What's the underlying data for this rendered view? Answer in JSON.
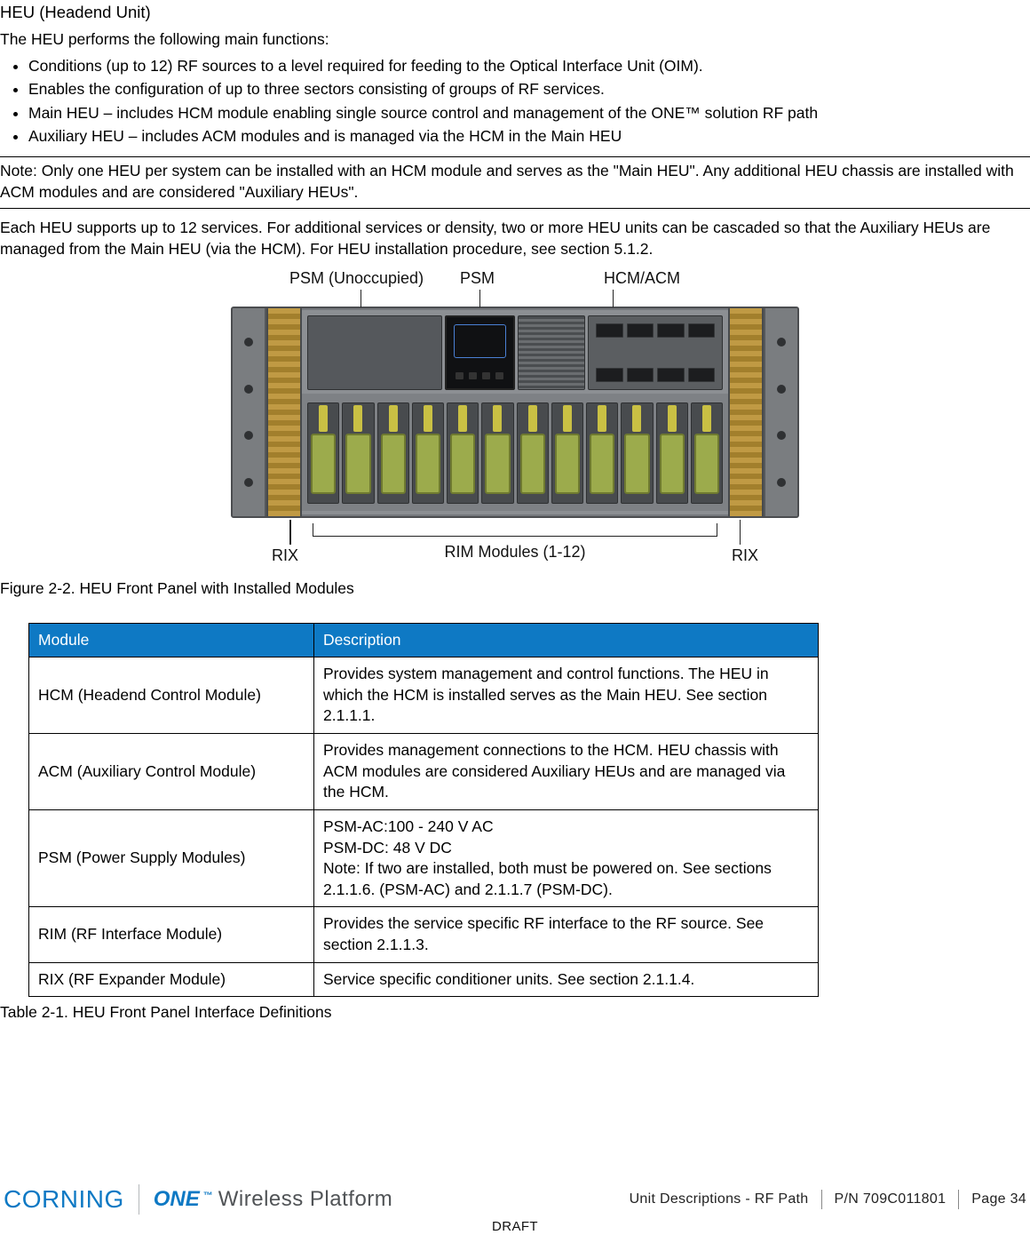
{
  "heading": "HEU (Headend Unit)",
  "intro": "The HEU performs the following main functions:",
  "bullets": [
    "Conditions (up to 12) RF sources to a level required for feeding to the Optical Interface Unit (OIM).",
    "Enables the configuration of up to three sectors consisting of groups of RF services.",
    "Main HEU – includes HCM module enabling single source control and management of the ONE™ solution RF path",
    "Auxiliary HEU – includes ACM modules and is managed via the HCM in the Main HEU"
  ],
  "note": "Note: Only one HEU per system can be installed with an HCM module and serves as the \"Main HEU\". Any additional HEU chassis are installed with ACM modules and are considered \"Auxiliary HEUs\".",
  "para2": "Each HEU supports up to 12 services. For additional services or density, two or more HEU units can be cascaded so that the Auxiliary HEUs are managed from the Main HEU (via the HCM). For HEU installation procedure, see section 5.1.2.",
  "figure": {
    "labels": {
      "psm_unoccupied": "PSM (Unoccupied)",
      "psm": "PSM",
      "hcm_acm": "HCM/ACM",
      "rix": "RIX",
      "rim_modules": "RIM Modules (1-12)"
    },
    "caption": "Figure 2-2. HEU Front Panel with Installed Modules"
  },
  "table": {
    "headers": {
      "module": "Module",
      "description": "Description"
    },
    "rows": [
      {
        "module": "HCM (Headend Control Module)",
        "description": "Provides system management and control functions. The HEU in which the HCM is installed serves as the Main HEU. See section 2.1.1.1."
      },
      {
        "module": "ACM (Auxiliary Control Module)",
        "description": "Provides management connections to the HCM. HEU chassis with ACM modules are considered Auxiliary HEUs and are managed via the HCM."
      },
      {
        "module": "PSM (Power Supply Modules)",
        "description": "PSM-AC:100 - 240 V AC\nPSM-DC: 48 V DC\nNote: If two are installed, both must be powered on. See sections 2.1.1.6. (PSM-AC) and 2.1.1.7 (PSM-DC)."
      },
      {
        "module": "RIM (RF Interface Module)",
        "description": "Provides the service specific RF interface to the RF source. See section 2.1.1.3."
      },
      {
        "module": "RIX (RF Expander Module)",
        "description": "Service specific conditioner units. See section 2.1.1.4."
      }
    ],
    "caption": "Table 2-1. HEU Front Panel Interface Definitions"
  },
  "footer": {
    "brand_corning": "CORNING",
    "brand_one": "ONE",
    "brand_tm": "™",
    "brand_rest": "Wireless Platform",
    "section": "Unit Descriptions - RF Path",
    "pn": "P/N 709C011801",
    "page": "Page 34",
    "draft": "DRAFT"
  }
}
